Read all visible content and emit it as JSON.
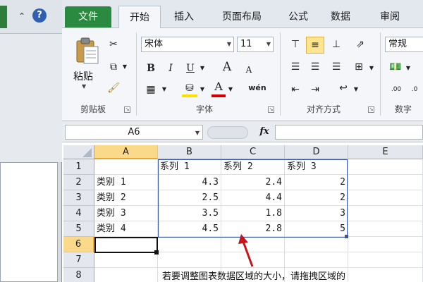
{
  "tabs": {
    "file": "文件",
    "home": "开始",
    "insert": "插入",
    "page_layout": "页面布局",
    "formulas": "公式",
    "data": "数据",
    "review": "审阅"
  },
  "ribbon": {
    "clipboard": {
      "paste_label": "粘贴",
      "group_label": "剪贴板"
    },
    "font": {
      "font_name": "宋体",
      "font_size": "11",
      "bold": "B",
      "italic": "I",
      "underline": "U",
      "grow": "A",
      "shrink": "A",
      "font_color": "A",
      "phonetic": "wén",
      "group_label": "字体"
    },
    "alignment": {
      "group_label": "对齐方式"
    },
    "number": {
      "format": "常规",
      "group_label": "数字"
    }
  },
  "formula_bar": {
    "name_box": "A6",
    "fx": "fx",
    "formula": ""
  },
  "sheet": {
    "columns": [
      "A",
      "B",
      "C",
      "D",
      "E"
    ],
    "rows": [
      "1",
      "2",
      "3",
      "4",
      "5",
      "6",
      "7",
      "8"
    ],
    "data": [
      [
        "",
        "系列 1",
        "系列 2",
        "系列 3"
      ],
      [
        "类别 1",
        "4.3",
        "2.4",
        "2"
      ],
      [
        "类别 2",
        "2.5",
        "4.4",
        "2"
      ],
      [
        "类别 3",
        "3.5",
        "1.8",
        "3"
      ],
      [
        "类别 4",
        "4.5",
        "2.8",
        "5"
      ]
    ],
    "note": "若要调整图表数据区域的大小，请拖拽区域的",
    "selected_cell": "A6"
  },
  "left_window": {
    "help": "?"
  },
  "colors": {
    "file_tab": "#2a8a3f",
    "selection_header": "#fbd98a",
    "range_border": "#3355aa",
    "arrow": "#c4151c"
  },
  "icons": [
    "cut-icon",
    "copy-icon",
    "format-painter-icon",
    "border-icon",
    "fill-color-icon",
    "align-top-icon",
    "align-middle-icon",
    "align-bottom-icon",
    "wrap-text-icon",
    "merge-center-icon",
    "indent-icon",
    "orientation-icon",
    "currency-icon",
    "fx-icon",
    "help-icon"
  ]
}
